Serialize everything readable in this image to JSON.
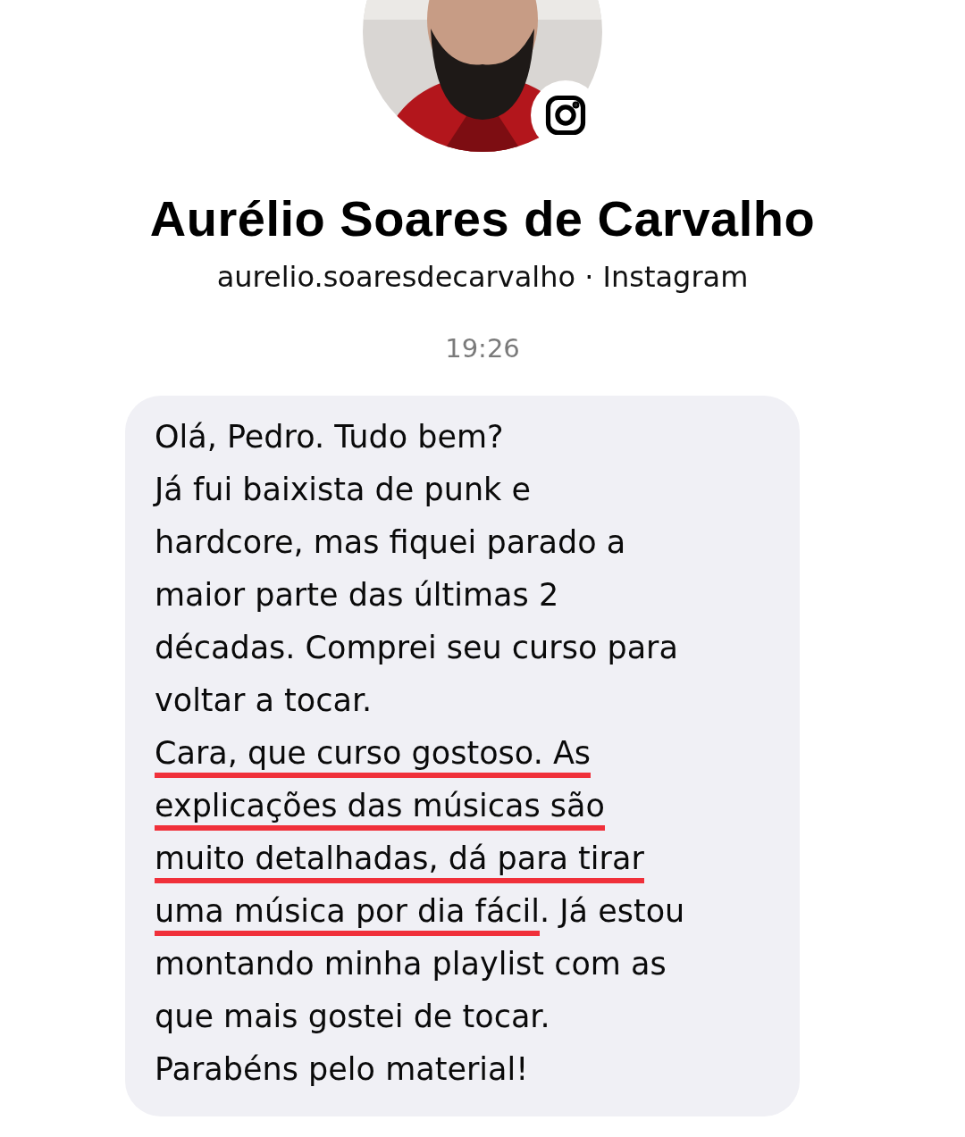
{
  "profile": {
    "name": "Aurélio Soares de Carvalho",
    "handle": "aurelio.soaresdecarvalho · Instagram"
  },
  "timestamp": "19:26",
  "message": {
    "lines": [
      [
        {
          "text": "Olá, Pedro. Tudo bem?",
          "underlined": false
        }
      ],
      [
        {
          "text": "Já fui baixista de punk e",
          "underlined": false
        }
      ],
      [
        {
          "text": "hardcore, mas fiquei parado a",
          "underlined": false
        }
      ],
      [
        {
          "text": "maior parte das últimas 2",
          "underlined": false
        }
      ],
      [
        {
          "text": "décadas. Comprei seu curso para",
          "underlined": false
        }
      ],
      [
        {
          "text": "voltar a tocar.",
          "underlined": false
        }
      ],
      [
        {
          "text": "Cara, que curso gostoso. As",
          "underlined": true
        }
      ],
      [
        {
          "text": "explicações das músicas são",
          "underlined": true
        }
      ],
      [
        {
          "text": "muito detalhadas, dá para tirar",
          "underlined": true
        }
      ],
      [
        {
          "text": "uma música por dia fácil",
          "underlined": true
        },
        {
          "text": ". Já estou",
          "underlined": false
        }
      ],
      [
        {
          "text": "montando minha playlist com as",
          "underlined": false
        }
      ],
      [
        {
          "text": "que mais gostei de tocar.",
          "underlined": false
        }
      ],
      [
        {
          "text": "Parabéns pelo material!",
          "underlined": false
        }
      ]
    ]
  }
}
